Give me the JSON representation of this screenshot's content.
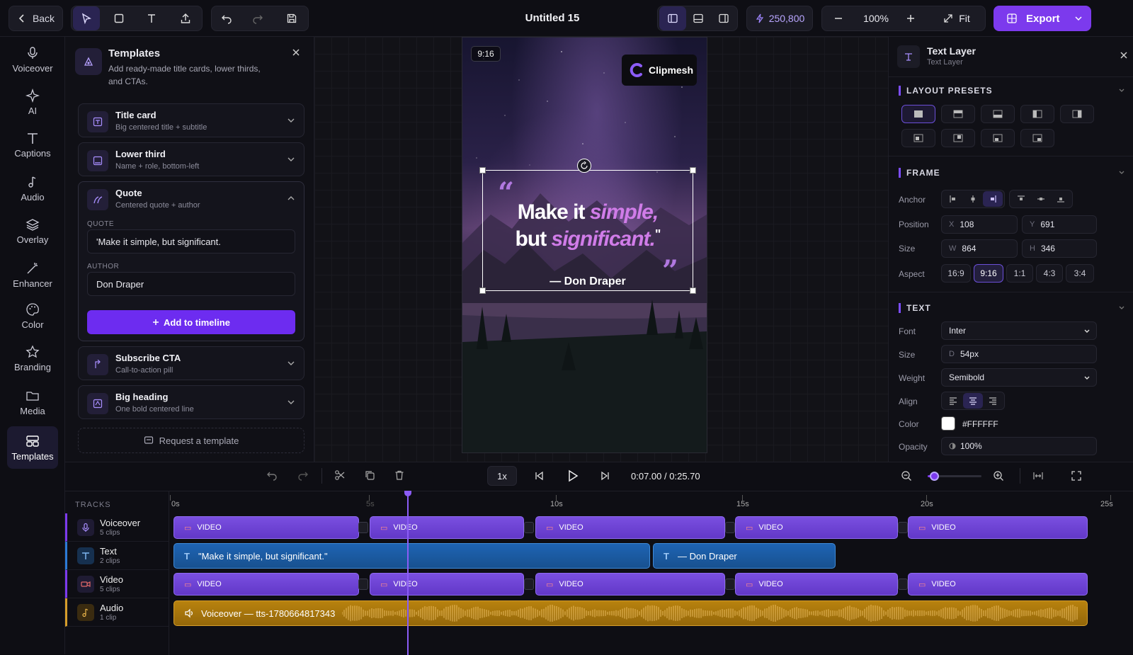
{
  "topbar": {
    "back_label": "Back",
    "title": "Untitled 15",
    "credits": "250,800",
    "zoom": "100%",
    "fit_label": "Fit",
    "export_label": "Export"
  },
  "rail": [
    {
      "label": "Voiceover",
      "icon": "mic-icon"
    },
    {
      "label": "AI",
      "icon": "sparkle-icon"
    },
    {
      "label": "Captions",
      "icon": "text-icon"
    },
    {
      "label": "Audio",
      "icon": "music-icon"
    },
    {
      "label": "Overlay",
      "icon": "layers-icon"
    },
    {
      "label": "Enhancer",
      "icon": "wand-icon"
    },
    {
      "label": "Color",
      "icon": "palette-icon"
    },
    {
      "label": "Branding",
      "icon": "star-icon"
    },
    {
      "label": "Media",
      "icon": "folder-icon"
    },
    {
      "label": "Templates",
      "icon": "templates-icon",
      "active": true
    }
  ],
  "templates": {
    "title": "Templates",
    "subtitle": "Add ready-made title cards, lower thirds, and CTAs.",
    "items": [
      {
        "title": "Title card",
        "sub": "Big centered title + subtitle"
      },
      {
        "title": "Lower third",
        "sub": "Name + role, bottom-left"
      },
      {
        "title": "Quote",
        "sub": "Centered quote + author"
      },
      {
        "title": "Subscribe CTA",
        "sub": "Call-to-action pill"
      },
      {
        "title": "Big heading",
        "sub": "One bold centered line"
      }
    ],
    "quote_label": "QUOTE",
    "quote_value": "'Make it simple, but significant.",
    "author_label": "AUTHOR",
    "author_value": "Don Draper",
    "add_button": "Add to timeline",
    "request_label": "Request a template"
  },
  "canvas": {
    "aspect_badge": "9:16",
    "brand": "Clipmesh",
    "quote_open": "“",
    "quote_close": "”",
    "line1_a": "Make it ",
    "line1_b": "simple,",
    "line2_a": "but ",
    "line2_b": "significant.",
    "line2_c": "\"",
    "author": "— Don Draper"
  },
  "inspector": {
    "title": "Text Layer",
    "subtitle": "Text Layer",
    "layout_presets_label": "LAYOUT PRESETS",
    "frame_label": "FRAME",
    "anchor_label": "Anchor",
    "position_label": "Position",
    "pos_x": "108",
    "pos_y": "691",
    "size_label": "Size",
    "size_w": "864",
    "size_h": "346",
    "aspect_label": "Aspect",
    "aspects": [
      "16:9",
      "9:16",
      "1:1",
      "4:3",
      "3:4"
    ],
    "text_label": "TEXT",
    "font_label": "Font",
    "font_value": "Inter",
    "fsize_label": "Size",
    "fsize_value": "54px",
    "weight_label": "Weight",
    "weight_value": "Semibold",
    "align_label": "Align",
    "color_label": "Color",
    "color_value": "#FFFFFF",
    "opacity_label": "Opacity",
    "opacity_value": "100%"
  },
  "transport": {
    "speed": "1x",
    "time_current": "0:07.00",
    "time_sep": "/",
    "time_total": "0:25.70"
  },
  "timeline": {
    "tracks_label": "TRACKS",
    "ticks": [
      "0s",
      "5s",
      "10s",
      "15s",
      "20s",
      "25s"
    ],
    "tracks": [
      {
        "name": "Voiceover",
        "count": "5 clips"
      },
      {
        "name": "Text",
        "count": "2 clips"
      },
      {
        "name": "Video",
        "count": "5 clips"
      },
      {
        "name": "Audio",
        "count": "1 clip"
      }
    ],
    "video_clip_label": "VIDEO",
    "text_clips": [
      "\"Make it simple, but significant.\"",
      "— Don Draper"
    ],
    "audio_clip": "Voiceover — tts-1780664817343"
  },
  "colors": {
    "accent": "#7c3aed",
    "text_clip": "#1e64b4",
    "audio_clip": "#b8820e"
  }
}
